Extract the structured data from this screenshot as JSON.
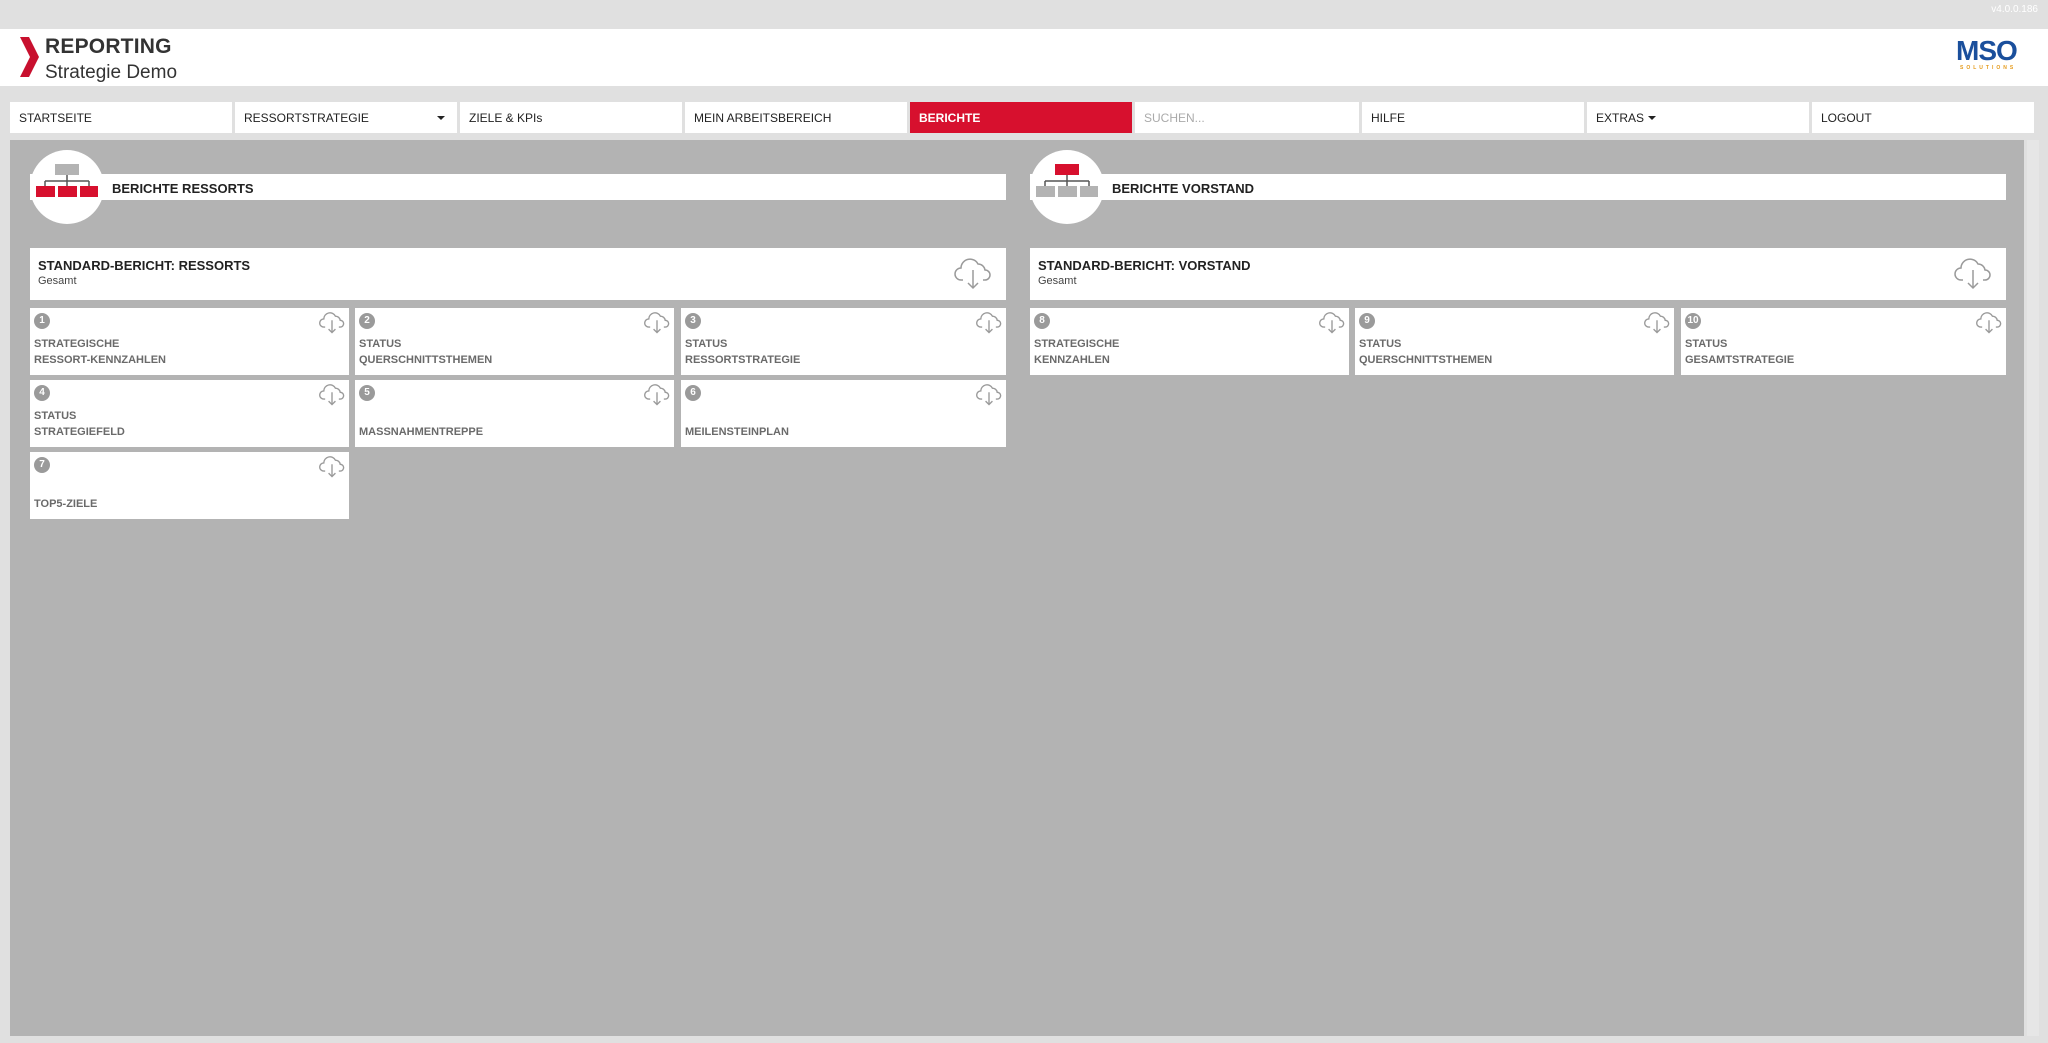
{
  "app": {
    "version": "v4.0.0.186",
    "title": "REPORTING",
    "subtitle": "Strategie Demo",
    "logo_text": "MSO",
    "logo_sub": "SOLUTIONS"
  },
  "nav": {
    "items": [
      {
        "label": "STARTSEITE"
      },
      {
        "label": "RESSORTSTRATEGIE"
      },
      {
        "label": "ZIELE & KPIs"
      },
      {
        "label": "MEIN ARBEITSBEREICH"
      },
      {
        "label": "BERICHTE"
      },
      {
        "label": "HILFE"
      },
      {
        "label": "EXTRAS"
      },
      {
        "label": "LOGOUT"
      }
    ],
    "search_placeholder": "SUCHEN..."
  },
  "colors": {
    "accent": "#d7102e",
    "brand_blue": "#1a4f9c",
    "brand_orange": "#e59a1a"
  },
  "panels": {
    "ressorts": {
      "title": "BERICHTE RESSORTS",
      "icon": "org-chart-icon",
      "standard": {
        "title": "STANDARD-BERICHT: RESSORTS",
        "subtitle": "Gesamt"
      },
      "reports": [
        {
          "num": "1",
          "line1": "STRATEGISCHE",
          "line2": "RESSORT-KENNZAHLEN"
        },
        {
          "num": "2",
          "line1": "STATUS",
          "line2": "QUERSCHNITTSTHEMEN"
        },
        {
          "num": "3",
          "line1": "STATUS",
          "line2": "RESSORTSTRATEGIE"
        },
        {
          "num": "4",
          "line1": "STATUS",
          "line2": "STRATEGIEFELD"
        },
        {
          "num": "5",
          "line1": "",
          "line2": "MASSNAHMENTREPPE"
        },
        {
          "num": "6",
          "line1": "",
          "line2": "MEILENSTEINPLAN"
        },
        {
          "num": "7",
          "line1": "",
          "line2": "TOP5-ZIELE"
        }
      ]
    },
    "vorstand": {
      "title": "BERICHTE VORSTAND",
      "icon": "org-chart-icon",
      "standard": {
        "title": "STANDARD-BERICHT: VORSTAND",
        "subtitle": "Gesamt"
      },
      "reports": [
        {
          "num": "8",
          "line1": "STRATEGISCHE",
          "line2": "KENNZAHLEN"
        },
        {
          "num": "9",
          "line1": "STATUS",
          "line2": "QUERSCHNITTSTHEMEN"
        },
        {
          "num": "10",
          "line1": "STATUS",
          "line2": "GESAMTSTRATEGIE"
        }
      ]
    }
  }
}
